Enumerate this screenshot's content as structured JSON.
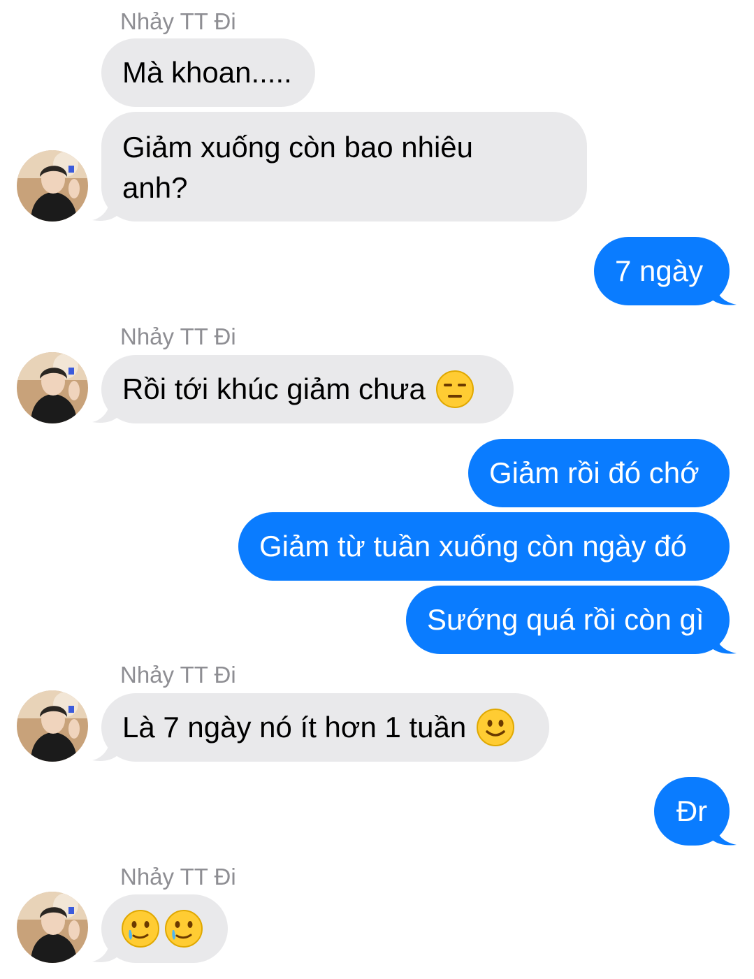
{
  "sender_name": "Nhảy TT Đi",
  "messages": [
    {
      "dir": "in",
      "text": "Mà khoan....."
    },
    {
      "dir": "in",
      "text": "Giảm xuống còn bao nhiêu anh?"
    },
    {
      "dir": "out",
      "text": "7 ngày"
    },
    {
      "dir": "in",
      "text": "Rồi tới khúc giảm chưa",
      "emoji": "expressionless-face-icon"
    },
    {
      "dir": "out",
      "text": "Giảm rồi đó chớ"
    },
    {
      "dir": "out",
      "text": "Giảm từ tuần xuống còn ngày đó"
    },
    {
      "dir": "out",
      "text": "Sướng quá rồi còn gì"
    },
    {
      "dir": "in",
      "text": "Là 7 ngày nó ít hơn 1 tuần",
      "emoji": "slightly-smiling-face-icon"
    },
    {
      "dir": "out",
      "text": "Đr"
    },
    {
      "dir": "in",
      "text": "",
      "emoji": "face-holding-back-tears-icon x2"
    }
  ],
  "colors": {
    "incoming_bubble": "#e9e9eb",
    "outgoing_bubble": "#0a7cff",
    "sender_label": "#8e8e93"
  }
}
